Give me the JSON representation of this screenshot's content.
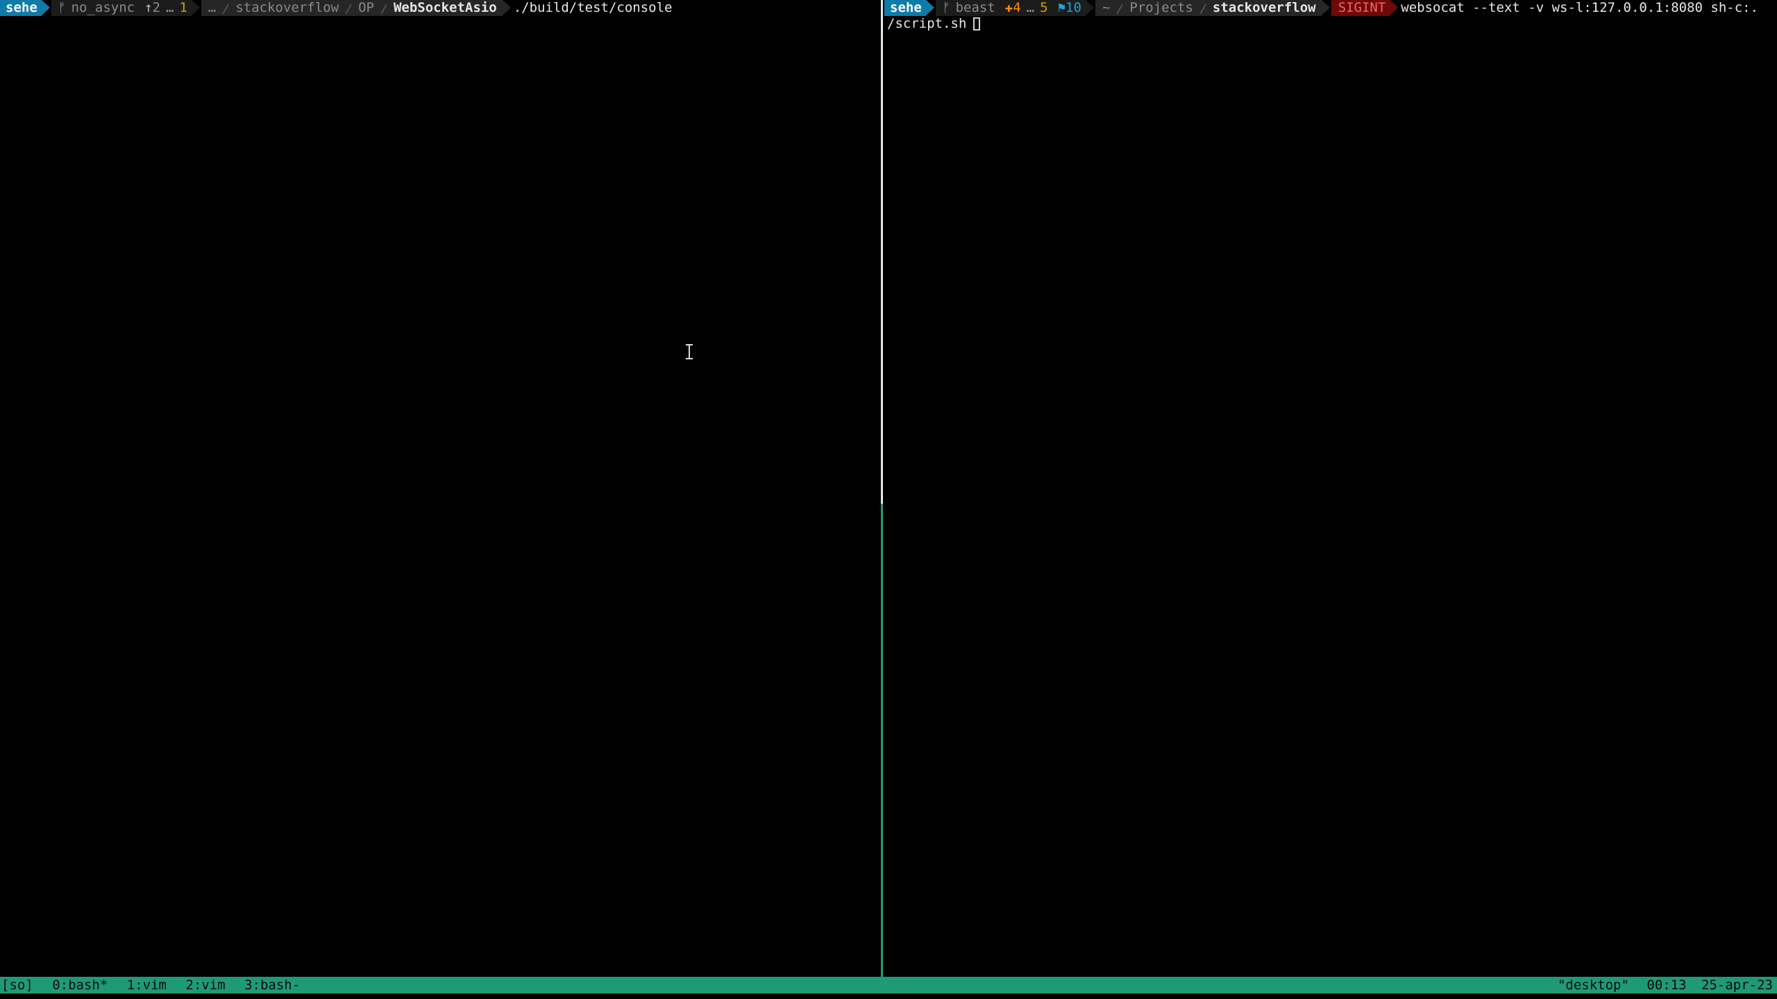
{
  "left_pane": {
    "prompt": {
      "user": "sehe",
      "git": {
        "branch_icon": "git-branch-icon",
        "branch": "no_async",
        "ahead_arrow": "↑",
        "ahead": "2",
        "dots": "…",
        "untracked": "1"
      },
      "path": [
        "…",
        "stackoverflow",
        "OP",
        "WebSocketAsio"
      ],
      "command": "./build/test/console"
    }
  },
  "right_pane": {
    "prompt": {
      "user": "sehe",
      "git": {
        "branch_icon": "git-branch-icon",
        "branch": "beast",
        "staged_sign": "✚",
        "staged": "4",
        "dots": "…",
        "untracked": "5",
        "flag_sign": "⚑",
        "stash": "10"
      },
      "path": [
        "~",
        "Projects",
        "stackoverflow"
      ],
      "signal": "SIGINT",
      "command_line1": "websocat --text -v ws-l:127.0.0.1:8080 sh-c:.",
      "command_line2": "/script.sh"
    }
  },
  "statusbar": {
    "session": "[so]",
    "windows": [
      "0:bash*",
      "1:vim",
      "2:vim",
      "3:bash-"
    ],
    "host": "\"desktop\"",
    "time": "00:13",
    "date": "25-apr-23"
  },
  "colors": {
    "user_bg": "#0f7ca8",
    "status_bg": "#1f9b74",
    "signal_bg": "#6e0a0a",
    "active_border": "#1fa07a"
  }
}
